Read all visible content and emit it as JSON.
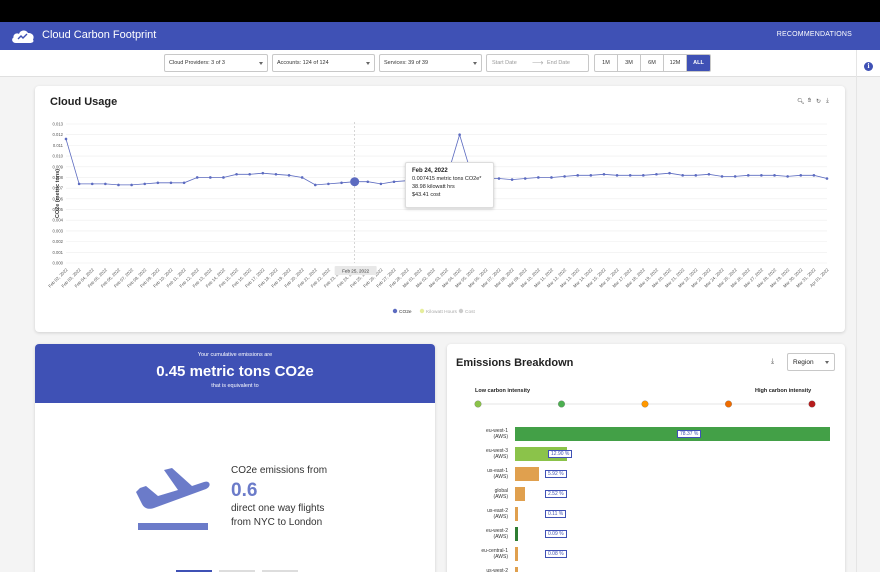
{
  "app": {
    "title": "Cloud Carbon Footprint",
    "nav_link": "RECOMMENDATIONS"
  },
  "filters": {
    "cloud_providers": "Cloud Providers: 3 of 3",
    "accounts": "Accounts: 124 of 124",
    "services": "Services: 39 of 39",
    "start_date_placeholder": "Start Date",
    "end_date_placeholder": "End Date",
    "ranges": [
      "1M",
      "3M",
      "6M",
      "12M",
      "ALL"
    ],
    "active_range": "ALL"
  },
  "usage": {
    "title": "Cloud Usage",
    "tooltip": {
      "date": "Feb 24, 2022",
      "co2e": "0.007415 metric tons CO2e*",
      "kwh": "38.98 kilowatt hrs",
      "cost": "$43.41 cost"
    },
    "crosshair_label": "Feb 25, 2022",
    "legend": [
      "CO2e",
      "Kilowatt Hours",
      "Cost"
    ]
  },
  "chart_data": {
    "type": "line",
    "ylabel": "CO2e (metric tons)",
    "ylim": [
      0,
      0.013
    ],
    "yticks": [
      "0.000",
      "0.001",
      "0.002",
      "0.003",
      "0.004",
      "0.005",
      "0.006",
      "0.007",
      "0.008",
      "0.009",
      "0.010",
      "0.011",
      "0.012",
      "0.013"
    ],
    "x": [
      "Feb 02, 2022",
      "Feb 03, 2022",
      "Feb 04, 2022",
      "Feb 05, 2022",
      "Feb 06, 2022",
      "Feb 07, 2022",
      "Feb 08, 2022",
      "Feb 09, 2022",
      "Feb 10, 2022",
      "Feb 11, 2022",
      "Feb 12, 2022",
      "Feb 13, 2022",
      "Feb 14, 2022",
      "Feb 15, 2022",
      "Feb 16, 2022",
      "Feb 17, 2022",
      "Feb 18, 2022",
      "Feb 19, 2022",
      "Feb 20, 2022",
      "Feb 21, 2022",
      "Feb 22, 2022",
      "Feb 23, 2022",
      "Feb 24, 2022",
      "Feb 25, 2022",
      "Feb 26, 2022",
      "Feb 27, 2022",
      "Feb 28, 2022",
      "Mar 01, 2022",
      "Mar 02, 2022",
      "Mar 03, 2022",
      "Mar 04, 2022",
      "Mar 05, 2022",
      "Mar 06, 2022",
      "Mar 07, 2022",
      "Mar 08, 2022",
      "Mar 09, 2022",
      "Mar 10, 2022",
      "Mar 11, 2022",
      "Mar 12, 2022",
      "Mar 13, 2022",
      "Mar 14, 2022",
      "Mar 15, 2022",
      "Mar 16, 2022",
      "Mar 17, 2022",
      "Mar 18, 2022",
      "Mar 19, 2022",
      "Mar 20, 2022",
      "Mar 21, 2022",
      "Mar 22, 2022",
      "Mar 23, 2022",
      "Mar 24, 2022",
      "Mar 25, 2022",
      "Mar 26, 2022",
      "Mar 27, 2022",
      "Mar 28, 2022",
      "Mar 29, 2022",
      "Mar 30, 2022",
      "Mar 31, 2022",
      "Apr 01, 2022"
    ],
    "xticks": [
      "Feb 02, 2022",
      "Feb 03, 2022",
      "Feb 04, 2022",
      "Feb 05, 2022",
      "Feb 06, 2022",
      "Feb 07, 2022",
      "Feb 08, 2022",
      "Feb 09, 2022",
      "Feb 10, 2022",
      "Feb 11, 2022",
      "Feb 12, 2022",
      "Feb 13, 2022",
      "Feb 14, 2022",
      "Feb 15, 2022",
      "Feb 16, 2022",
      "Feb 17, 2022",
      "Feb 18, 2022",
      "Feb 19, 2022",
      "Feb 20, 2022",
      "Feb 21, 2022",
      "Feb 22, 2022",
      "Feb 23, 2022",
      "Feb 24, 2022",
      "Feb 25, 2022",
      "Feb 26, 2022",
      "Feb 27, 2022",
      "Feb 28, 2022",
      "Mar 01, 2022",
      "Mar 02, 2022",
      "Mar 03, 2022",
      "Mar 04, 2022",
      "Mar 05, 2022",
      "Mar 06, 2022",
      "Mar 07, 2022",
      "Mar 08, 2022",
      "Mar 09, 2022",
      "Mar 10, 2022",
      "Mar 11, 2022",
      "Mar 12, 2022",
      "Mar 13, 2022",
      "Mar 14, 2022",
      "Mar 15, 2022",
      "Mar 16, 2022",
      "Mar 17, 2022",
      "Mar 18, 2022",
      "Mar 19, 2022",
      "Mar 20, 2022",
      "Mar 21, 2022",
      "Mar 22, 2022",
      "Mar 23, 2022",
      "Mar 24, 2022",
      "Mar 25, 2022",
      "Mar 26, 2022",
      "Mar 27, 2022",
      "Mar 28, 2022",
      "Mar 29, 2022",
      "Mar 30, 2022",
      "Mar 31, 2022",
      "Apr 01, 2022"
    ],
    "series": [
      {
        "name": "CO2e",
        "values": [
          0.0116,
          0.0074,
          0.0074,
          0.0074,
          0.0073,
          0.0073,
          0.0074,
          0.0075,
          0.0075,
          0.0075,
          0.008,
          0.008,
          0.008,
          0.0083,
          0.0083,
          0.0084,
          0.0083,
          0.0082,
          0.008,
          0.0073,
          0.0074,
          0.0075,
          0.0076,
          0.0076,
          0.0074,
          0.0076,
          0.0077,
          0.0077,
          0.0078,
          0.0079,
          0.012,
          0.0079,
          0.0079,
          0.0079,
          0.0078,
          0.0079,
          0.008,
          0.008,
          0.0081,
          0.0082,
          0.0082,
          0.0083,
          0.0082,
          0.0082,
          0.0082,
          0.0083,
          0.0084,
          0.0082,
          0.0082,
          0.0083,
          0.0081,
          0.0081,
          0.0082,
          0.0082,
          0.0082,
          0.0081,
          0.0082,
          0.0082,
          0.0079,
          0.0079,
          0.008,
          0.008,
          0.008,
          0.008
        ]
      }
    ],
    "highlight_index": 22,
    "grid": true,
    "legend_position": "bottom"
  },
  "emissions": {
    "line1": "Your cumulative emissions are",
    "headline": "0.45 metric tons CO2e",
    "line3": "that is equivalent to",
    "eq_prefix": "CO2e emissions from",
    "eq_number": "0.6",
    "eq_line1": "direct one way flights",
    "eq_line2": "from NYC to London"
  },
  "breakdown": {
    "title": "Emissions Breakdown",
    "group_by": "Region",
    "low_label": "Low carbon intensity",
    "high_label": "High carbon intensity",
    "intensity_colors": [
      "#8bc34a",
      "#4caf50",
      "#ff9800",
      "#ef6c00",
      "#b71c1c"
    ],
    "regions": [
      {
        "name": "eu-west-1",
        "provider": "(AWS)",
        "percent": "78.37 %",
        "value": 78.37,
        "color": "#43a047"
      },
      {
        "name": "eu-west-3",
        "provider": "(AWS)",
        "percent": "12.90 %",
        "value": 12.9,
        "color": "#8bc34a"
      },
      {
        "name": "us-east-1",
        "provider": "(AWS)",
        "percent": "5.92 %",
        "value": 5.92,
        "color": "#e0a04e"
      },
      {
        "name": "global",
        "provider": "(AWS)",
        "percent": "2.52 %",
        "value": 2.52,
        "color": "#e0a04e"
      },
      {
        "name": "us-east-2",
        "provider": "(AWS)",
        "percent": "0.11 %",
        "value": 0.11,
        "color": "#e0a04e"
      },
      {
        "name": "eu-west-2",
        "provider": "(AWS)",
        "percent": "0.09 %",
        "value": 0.09,
        "color": "#2e7d32"
      },
      {
        "name": "eu-central-1",
        "provider": "(AWS)",
        "percent": "0.08 %",
        "value": 0.08,
        "color": "#e0a04e"
      },
      {
        "name": "us-west-2",
        "provider": "",
        "percent": "",
        "value": 0.05,
        "color": "#e0a04e"
      }
    ]
  }
}
